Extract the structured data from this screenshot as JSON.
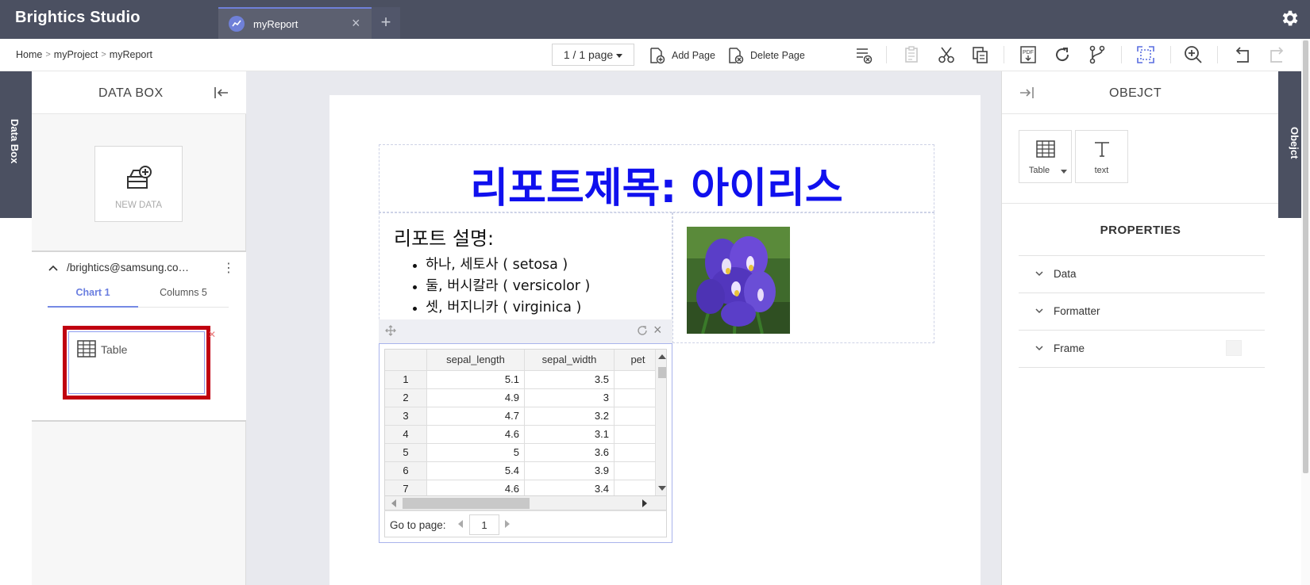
{
  "app": {
    "title": "Brightics Studio"
  },
  "tabs": [
    {
      "label": "myReport"
    }
  ],
  "icons": {
    "tab": "chart-line-icon",
    "add_tab": "plus-icon",
    "settings": "gear-icon",
    "new_data": "database-add-icon",
    "table": "table-grid-icon",
    "text": "text-T-icon"
  },
  "breadcrumb": {
    "home": "Home",
    "project": "myProject",
    "report": "myReport"
  },
  "toolbar": {
    "page_select": "1 / 1 page",
    "add_page": "Add Page",
    "delete_page": "Delete Page"
  },
  "left_tab": {
    "label": "Data Box"
  },
  "databox": {
    "title": "DATA BOX",
    "new_data_label": "NEW DATA",
    "datasource_path": "/brightics@samsung.co…",
    "tabs": {
      "chart": "Chart 1",
      "columns": "Columns 5"
    },
    "items": [
      {
        "label": "Table"
      }
    ]
  },
  "report": {
    "title": "리포트제목: 아이리스",
    "description_heading": "리포트 설명:",
    "description_items": [
      "하나, 세토사 ( setosa )",
      "둘, 버시칼라 ( versicolor )",
      "셋, 버지니카 ( virginica )"
    ],
    "table": {
      "columns": [
        "sepal_length",
        "sepal_width",
        "pet"
      ],
      "rows": [
        {
          "idx": "1",
          "c1": "5.1",
          "c2": "3.5"
        },
        {
          "idx": "2",
          "c1": "4.9",
          "c2": "3"
        },
        {
          "idx": "3",
          "c1": "4.7",
          "c2": "3.2"
        },
        {
          "idx": "4",
          "c1": "4.6",
          "c2": "3.1"
        },
        {
          "idx": "5",
          "c1": "5",
          "c2": "3.6"
        },
        {
          "idx": "6",
          "c1": "5.4",
          "c2": "3.9"
        },
        {
          "idx": "7",
          "c1": "4.6",
          "c2": "3.4"
        }
      ],
      "pager_label": "Go to page:",
      "page_value": "1"
    }
  },
  "object_panel": {
    "title": "OBEJCT",
    "tools": {
      "table": "Table",
      "text": "text"
    },
    "properties_title": "PROPERTIES",
    "properties": {
      "data": "Data",
      "formatter": "Formatter",
      "frame": "Frame"
    }
  },
  "right_tab": {
    "label": "Obejct"
  },
  "colors": {
    "topbar": "#4b5061",
    "accent": "#6f80d8",
    "report_title": "#1010ee",
    "highlight": "#c00010"
  }
}
